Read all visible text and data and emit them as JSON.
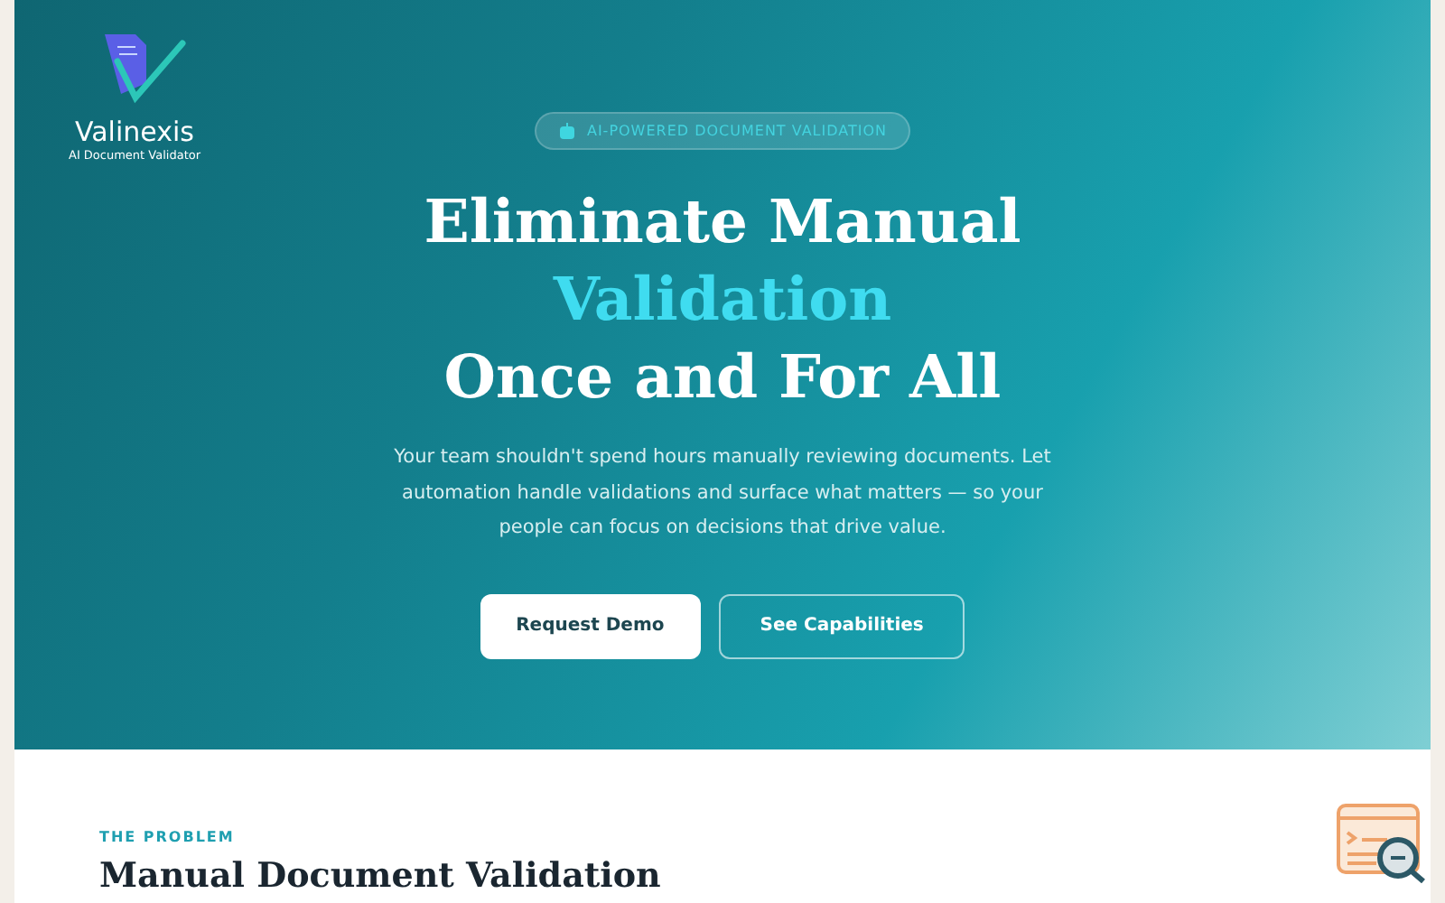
{
  "brand": {
    "name": "Valinexis",
    "tagline": "AI Document Validator"
  },
  "hero": {
    "badge": "AI-POWERED DOCUMENT VALIDATION",
    "title_lines": [
      {
        "text": "Eliminate Manual",
        "accent": false
      },
      {
        "text": "Validation",
        "accent": true
      },
      {
        "text": "Once and For All",
        "accent": false
      }
    ],
    "description": "Your team shouldn't spend hours manually reviewing documents. Let automation handle validations and surface what matters — so your people can focus on decisions that drive value.",
    "buttons": [
      {
        "label": "Request Demo",
        "kind": "primary"
      },
      {
        "label": "See Capabilities",
        "kind": "outline"
      }
    ]
  },
  "problem": {
    "eyebrow": "THE PROBLEM",
    "heading": "Manual Document Validation"
  }
}
